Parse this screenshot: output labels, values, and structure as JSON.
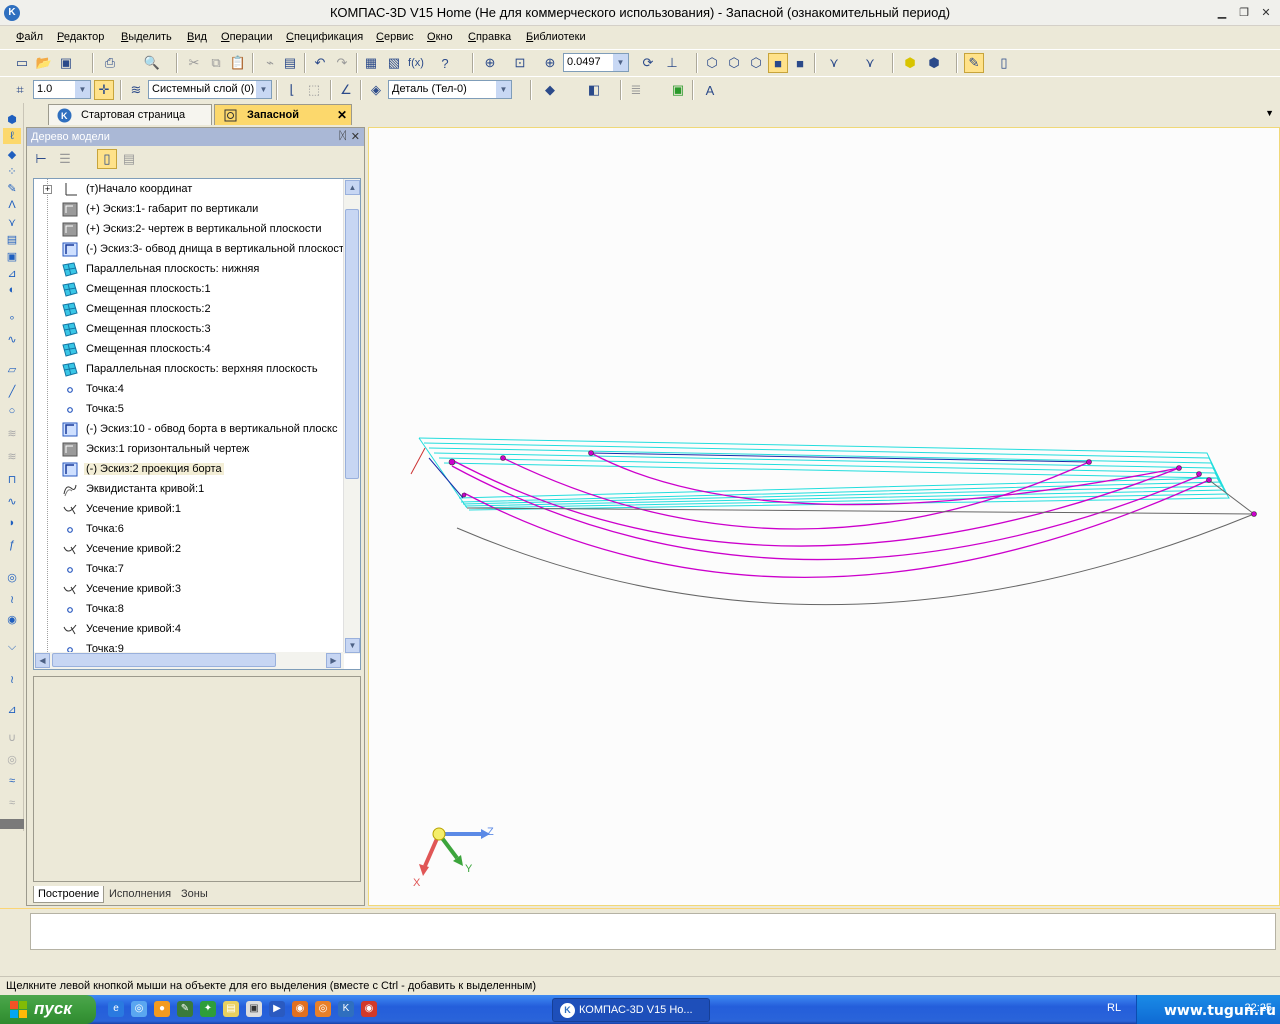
{
  "window": {
    "title": "КОМПАС-3D V15 Home (Не для коммерческого использования) - Запасной (ознакомительный период)"
  },
  "menu": [
    "Файл",
    "Редактор",
    "Выделить",
    "Вид",
    "Операции",
    "Спецификация",
    "Сервис",
    "Окно",
    "Справка",
    "Библиотеки"
  ],
  "toolbar1": {
    "zoom_value": "0.0497"
  },
  "toolbar2": {
    "step_value": "1.0",
    "layer_value": "Системный слой (0)",
    "part_value": "Деталь (Тел-0)"
  },
  "doc_tabs": [
    {
      "label": "Стартовая страница",
      "active": false
    },
    {
      "label": "Запасной",
      "active": true
    }
  ],
  "panel": {
    "title": "Дерево модели",
    "bottom_tabs": [
      "Построение",
      "Исполнения",
      "Зоны"
    ]
  },
  "tree": [
    {
      "label": "(т)Начало координат",
      "icon": "origin-icon"
    },
    {
      "label": "(+) Эскиз:1- габарит по вертикали",
      "icon": "sketch-icon"
    },
    {
      "label": "(+) Эскиз:2- чертеж в вертикальной плоскости",
      "icon": "sketch-icon"
    },
    {
      "label": "(-) Эскиз:3- обвод днища в вертикальной плоскост",
      "icon": "sketch-blue-icon"
    },
    {
      "label": "Параллельная плоскость: нижняя",
      "icon": "plane-icon"
    },
    {
      "label": "Смещенная плоскость:1",
      "icon": "plane-icon"
    },
    {
      "label": "Смещенная плоскость:2",
      "icon": "plane-icon"
    },
    {
      "label": "Смещенная плоскость:3",
      "icon": "plane-icon"
    },
    {
      "label": "Смещенная плоскость:4",
      "icon": "plane-icon"
    },
    {
      "label": "Параллельная плоскость: верхняя плоскость",
      "icon": "plane-icon"
    },
    {
      "label": "Точка:4",
      "icon": "point-icon"
    },
    {
      "label": "Точка:5",
      "icon": "point-icon"
    },
    {
      "label": "(-) Эскиз:10 - обвод борта в вертикальной плоскс",
      "icon": "sketch-blue-icon"
    },
    {
      "label": "Эскиз:1 горизонтальный чертеж",
      "icon": "sketch-icon"
    },
    {
      "label": "(-) Эскиз:2 проекция борта",
      "icon": "sketch-blue-icon",
      "selected": true
    },
    {
      "label": "Эквидистанта кривой:1",
      "icon": "curve-icon"
    },
    {
      "label": "Усечение кривой:1",
      "icon": "trim-icon"
    },
    {
      "label": "Точка:6",
      "icon": "point-icon"
    },
    {
      "label": "Усечение кривой:2",
      "icon": "trim-icon"
    },
    {
      "label": "Точка:7",
      "icon": "point-icon"
    },
    {
      "label": "Усечение кривой:3",
      "icon": "trim-icon"
    },
    {
      "label": "Точка:8",
      "icon": "point-icon"
    },
    {
      "label": "Усечение кривой:4",
      "icon": "trim-icon"
    },
    {
      "label": "Точка:9",
      "icon": "point-icon"
    }
  ],
  "axes": {
    "x": "X",
    "y": "Y",
    "z": "Z"
  },
  "status": {
    "hint": "Щелкните левой кнопкой мыши на объекте для его выделения (вместе с Ctrl - добавить к выделенным)"
  },
  "taskbar": {
    "start_label": "пуск",
    "task_label": "КОМПАС-3D V15 Но...",
    "lang": "RL",
    "clock": "22:25"
  },
  "watermark": "www.tugun.ru",
  "colors": {
    "accent_yellow": "#fcd86c",
    "curve_magenta": "#cc00cc",
    "grid_cyan": "#22dddd"
  }
}
